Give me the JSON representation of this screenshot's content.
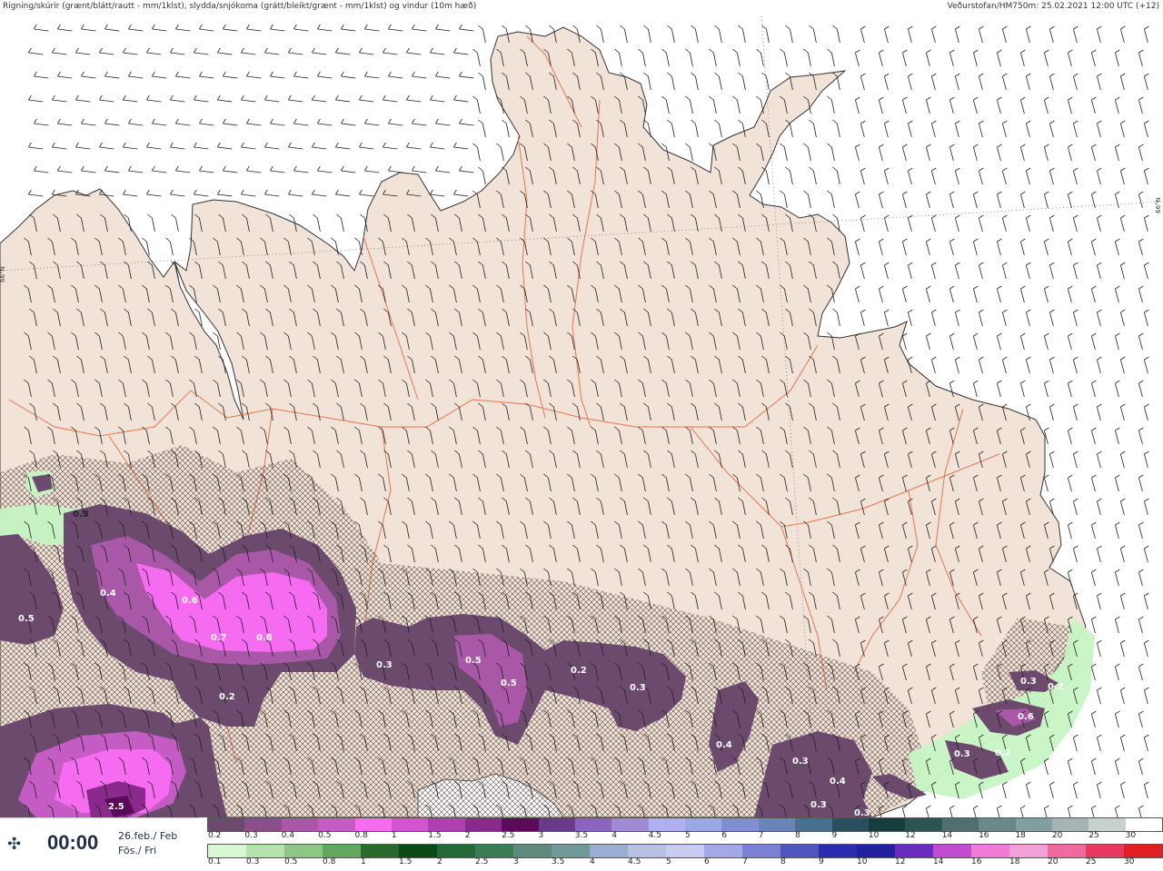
{
  "header": {
    "left_text": "Rigning/skúrir (grænt/blátt/rautt - mm/1klst), slydda/snjókoma (grátt/bleikt/grænt - mm/1klst) og vindur (10m hæð)",
    "right_text": "Veðurstofan/HM750m: 25.02.2021 12:00 UTC (+12)"
  },
  "lat_label": "66°N",
  "time_panel": {
    "icon": "wind-compass-icon",
    "time": "00:00",
    "date_line1": "26.feb./ Feb",
    "date_line2": "Fös./ Fri"
  },
  "legend_snow": {
    "labels": [
      "0.2",
      "0.3",
      "0.4",
      "0.5",
      "0.8",
      "1",
      "1.5",
      "2",
      "2.5",
      "3",
      "3.5",
      "4",
      "4.5",
      "5",
      "6",
      "7",
      "8",
      "9",
      "10",
      "12",
      "14",
      "16",
      "18",
      "20",
      "25",
      "30"
    ],
    "colors": [
      "#6b4a6e",
      "#8b4f8c",
      "#a958a8",
      "#c45cc4",
      "#f56cf0",
      "#d254d0",
      "#b040b0",
      "#8a2a8c",
      "#5c0a5a",
      "#6a3a8a",
      "#8a64c0",
      "#a08ad4",
      "#b0b0f0",
      "#9aa8e4",
      "#7f8fcf",
      "#6a84b8",
      "#46708e",
      "#2a4e5e",
      "#173e3e",
      "#2c5450",
      "#507070",
      "#6a8a88",
      "#80a0a0",
      "#a6b4b6",
      "#c8d0d0",
      "#ffffff"
    ]
  },
  "legend_rain": {
    "labels": [
      "0.1",
      "0.3",
      "0.5",
      "0.8",
      "1",
      "1.5",
      "2",
      "2.5",
      "3",
      "3.5",
      "4",
      "4.5",
      "5",
      "6",
      "7",
      "8",
      "9",
      "10",
      "12",
      "14",
      "16",
      "18",
      "20",
      "25",
      "30"
    ],
    "colors": [
      "#d8f8d4",
      "#b4e4ac",
      "#8cc884",
      "#64a860",
      "#2a6a2a",
      "#0c4a18",
      "#246a38",
      "#3a7c56",
      "#5c8a7c",
      "#6e9a98",
      "#9aaed4",
      "#b8c0e8",
      "#c8ccf4",
      "#a4a8e4",
      "#7a80d4",
      "#5056c0",
      "#2c2cb0",
      "#2020a0",
      "#6a2cc0",
      "#c04cd0",
      "#f07cd8",
      "#f4a0d8",
      "#f06aa0",
      "#e83a60",
      "#e02020"
    ]
  },
  "precip_labels": [
    "0.5",
    "0.3",
    "0.4",
    "0.6",
    "0.7",
    "0.8",
    "0.2",
    "0.3",
    "0.5",
    "0.5",
    "0.2",
    "0.3",
    "0.4",
    "0.3",
    "0.4",
    "0.3",
    "0.3",
    "2.5",
    "0.3",
    "0.2",
    "0.6",
    "0.3",
    "0.2"
  ]
}
